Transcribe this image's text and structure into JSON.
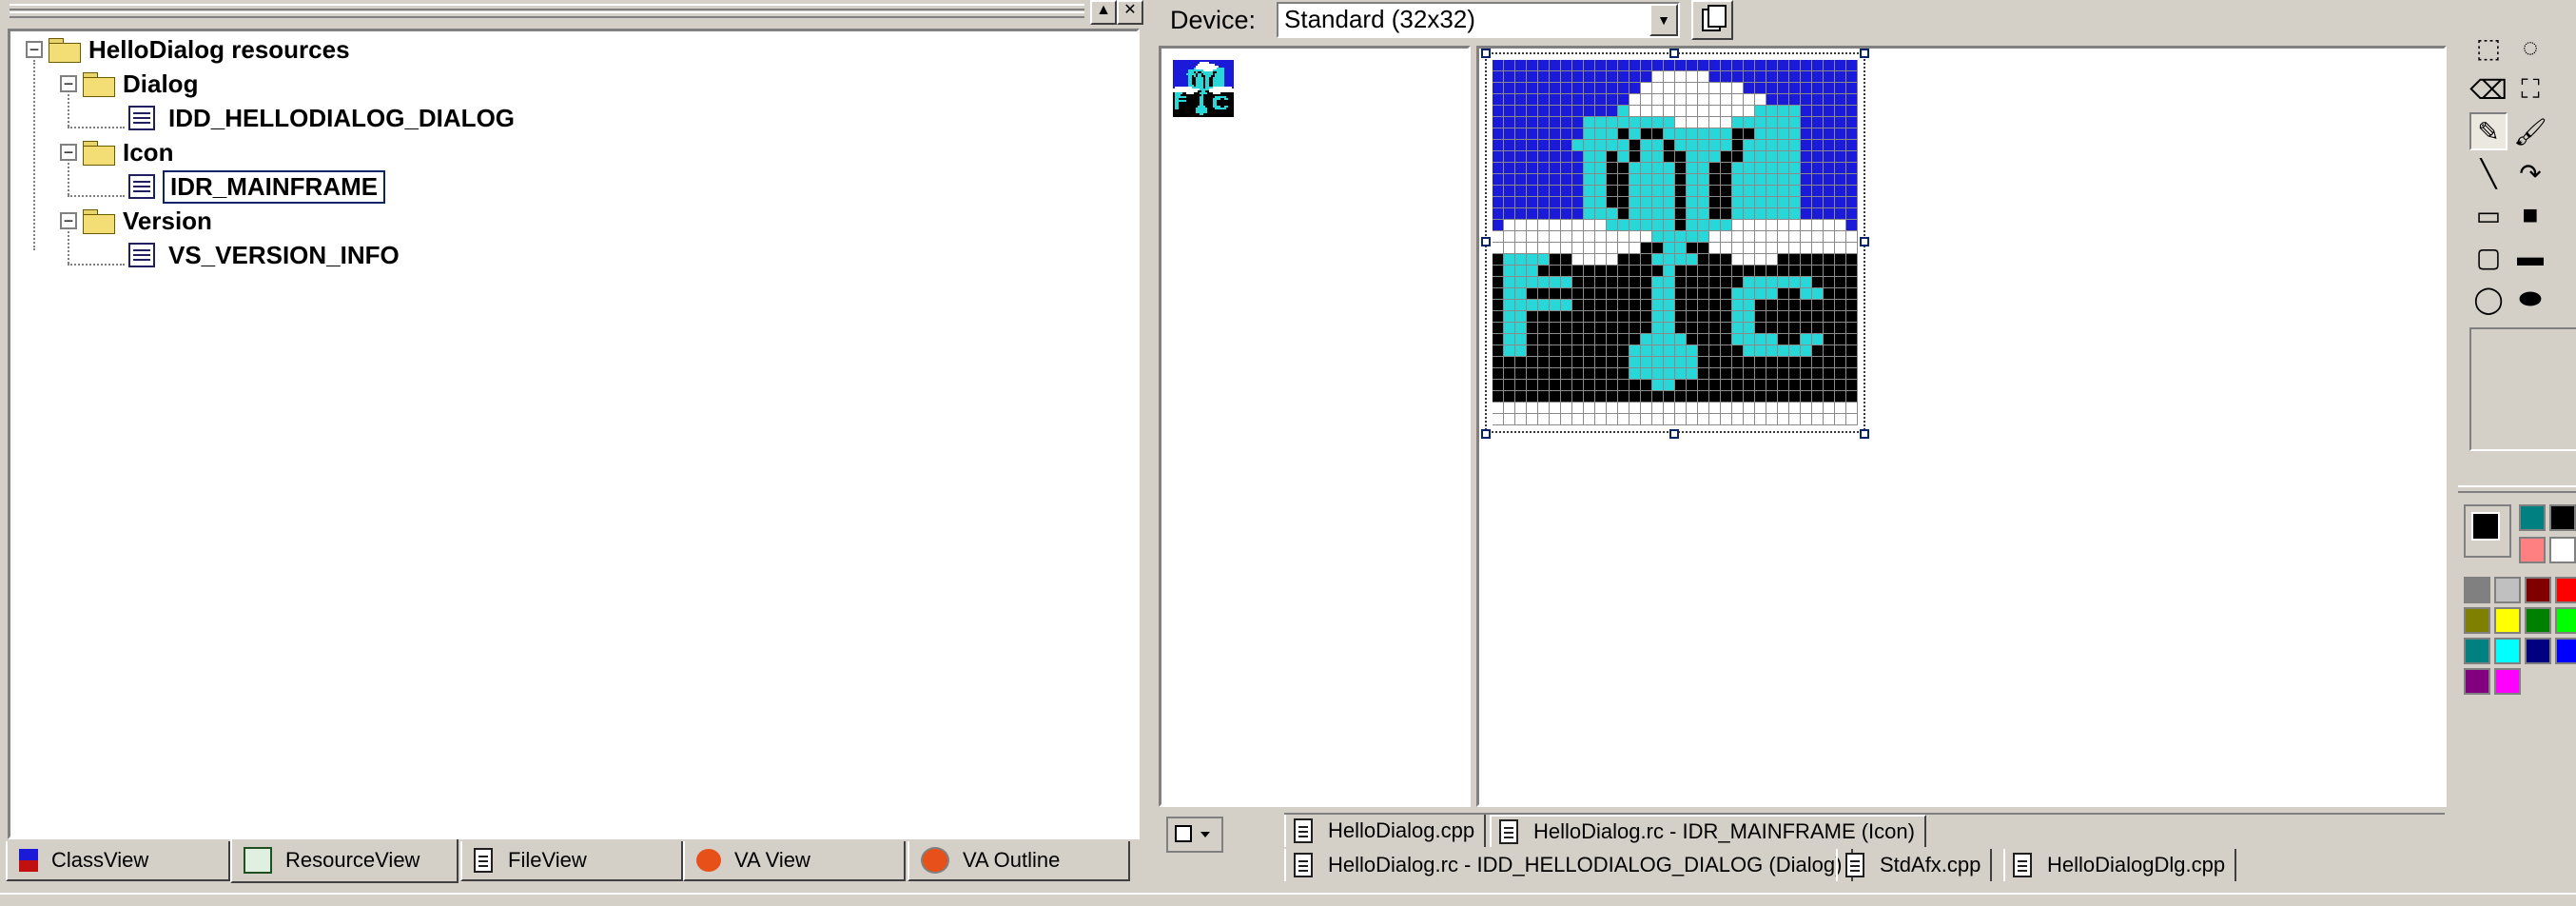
{
  "workspace": {
    "pin_label": "▲",
    "close_label": "✕",
    "tree": {
      "root": "HelloDialog resources",
      "folders": [
        {
          "label": "Dialog",
          "items": [
            "IDD_HELLODIALOG_DIALOG"
          ]
        },
        {
          "label": "Icon",
          "items": [
            "IDR_MAINFRAME"
          ]
        },
        {
          "label": "Version",
          "items": [
            "VS_VERSION_INFO"
          ]
        }
      ],
      "selected": "IDR_MAINFRAME"
    },
    "tabs": [
      "ClassView",
      "ResourceView",
      "FileView",
      "VA View",
      "VA Outline"
    ],
    "active_tab": "ResourceView"
  },
  "editor": {
    "device_label": "Device:",
    "device_value": "Standard (32x32)",
    "dropdown_glyph": "▼",
    "icon_rows": [
      "22222222222222222222222222222222",
      "22222222222222111112222222222222",
      "22222222222221111111112222222222",
      "22222222222211111111111122222222",
      "22222222222311111111111333322222",
      "22222222333333331111133333322222",
      "22222222333030033333300333322222",
      "22222223333303303333303333322222",
      "22222222330303300333003333322222",
      "22222222330033330330033333322222",
      "22222222330033330330033333322222",
      "22222222330033330330033333322222",
      "22222222330033330330033333322222",
      "22222222333033330330033333322222",
      "21111111113333330333311111111112",
      "11111111111111333331111111111111",
      "11111111111110033001111111111111",
      "03333001111000333300011110000000",
      "03330000000000030000000000000000",
      "03333330000000330000003333330000",
      "03300000000000330000033330033000",
      "03333330000000330000033000000000",
      "03300000000000330000033000000000",
      "03300000000000330000033000000000",
      "03300000000003333000033330033000",
      "03300000000033333300003333330000",
      "00000000000033333300000000000000",
      "00000000000033333300000000000000",
      "00000000000000330000000000000000",
      "00000000000000000000000000000000",
      "11111111111111111111111111111111",
      "11111111111111111111111111111111"
    ],
    "palette_map": {
      "0": "#000000",
      "1": "#ffffff",
      "2": "#1a1ad8",
      "3": "#28d8d8"
    },
    "doc_tabs_row1": [
      "HelloDialog.cpp",
      "HelloDialog.rc - IDR_MAINFRAME (Icon)"
    ],
    "doc_tabs_row2": [
      "HelloDialog.rc - IDD_HELLODIALOG_DIALOG (Dialog)",
      "StdAfx.cpp",
      "HelloDialogDlg.cpp"
    ],
    "active_doc": "HelloDialog.rc - IDR_MAINFRAME (Icon)"
  },
  "tools": {
    "glyphs": [
      "⬚",
      "◌",
      "⌫",
      "⛶",
      "✎",
      "🖌",
      "╲",
      "↷",
      "▭",
      "■",
      "▢",
      "▬",
      "◯",
      "⬬"
    ]
  },
  "colors": [
    "#808080",
    "#c0c0c0",
    "#800000",
    "#ff0000",
    "#808000",
    "#ffff00",
    "#008000",
    "#00ff00",
    "#008080",
    "#00ffff",
    "#000080",
    "#0000ff",
    "#800080",
    "#ff00ff"
  ]
}
